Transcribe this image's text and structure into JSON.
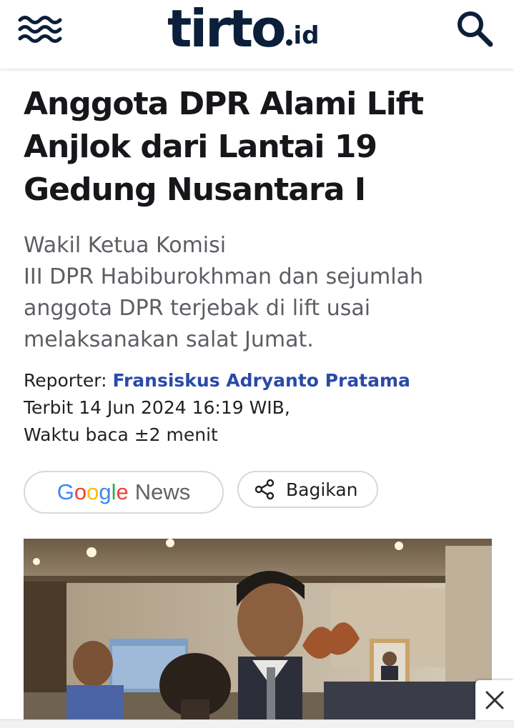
{
  "header": {
    "logo_main": "tirto",
    "logo_tld": "id",
    "menu_icon": "waves-menu-icon",
    "search_icon": "search-icon",
    "brand_color": "#0b1f3a"
  },
  "article": {
    "headline": "Anggota DPR Alami Lift Anjlok dari Lantai 19 Gedung Nusantara I",
    "lede_lines": [
      "Wakil Ketua Komisi",
      "III DPR Habiburokhman dan sejumlah",
      "anggota DPR terjebak di lift usai",
      "melaksanakan salat Jumat."
    ],
    "reporter_label": "Reporter:",
    "reporter_name": "Fransiskus Adryanto Pratama",
    "published": "Terbit 14 Jun 2024 16:19 WIB,",
    "read_time": "Waktu baca ±2 menit",
    "link_color": "#2b4aa8"
  },
  "actions": {
    "google_news": {
      "google_letters": [
        "G",
        "o",
        "o",
        "g",
        "l",
        "e"
      ],
      "news": "News"
    },
    "share_label": "Bagikan",
    "share_icon": "share-icon"
  },
  "hero_image": {
    "subject": "photo"
  },
  "ad": {
    "close_icon": "close-icon"
  }
}
